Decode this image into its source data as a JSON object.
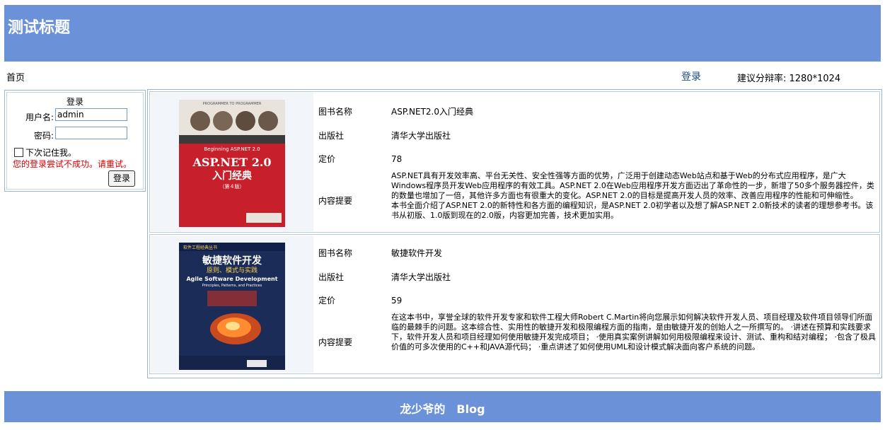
{
  "header": {
    "title": "测试标题"
  },
  "nav": {
    "home": "首页",
    "login": "登录",
    "resolution": "建议分辩率: 1280*1024"
  },
  "login": {
    "title": "登录",
    "username_label": "用户名:",
    "username_value": "admin",
    "password_label": "密码:",
    "password_value": "",
    "remember_label": "下次记住我。",
    "error": "您的登录尝试不成功。请重试。",
    "button": "登录"
  },
  "labels": {
    "name": "图书名称",
    "publisher": "出版社",
    "price": "定价",
    "summary": "内容提要"
  },
  "books": [
    {
      "name": "ASP.NET2.0入门经典",
      "publisher": "清华大学出版社",
      "price": "78",
      "summary": "ASP.NET具有开发效率高、平台无关性、安全性强等方面的优势，广泛用于创建动态Web站点和基于Web的分布式应用程序，是广大Windows程序员开发Web应用程序的有效工具。ASP.NET 2.0在Web应用程序开发方面迈出了革命性的一步，新增了50多个服务器控件，类的数量也增加了一倍，其他许多方面也有很重大的变化。ASP.NET 2.0的目标是提高开发人员的效率、改善应用程序的性能和可伸缩性。　　本书全面介绍了ASP.NET 2.0的新特性和各方面的编程知识，是ASP.NET 2.0初学者以及想了解ASP.NET 2.0新技术的读者的理想参考书。该书从初版、1.0版到现在的2.0版，内容更加完善，技术更加实用。",
      "cover": {
        "top_text": "PROGRAMMER TO PROGRAMMER",
        "subtitle": "Beginning ASP.NET 2.0",
        "title": "ASP.NET 2.0",
        "title_cn": "入门经典",
        "edition": "（第４版）",
        "bg": "#c8202a"
      }
    },
    {
      "name": "敏捷软件开发",
      "publisher": "清华大学出版社",
      "price": "59",
      "summary": "在这本书中，享誉全球的软件开发专家和软件工程大师Robert C.Martin将向您展示如何解决软件开发人员、项目经理及软件项目领导们所面临的最棘手的问题。这本综合性、实用性的敏捷开发和极限编程方面的指南，是由敏捷开发的创始人之一所撰写的。 ·讲述在预算和实践要求下，软件开发人员和项目经理如何使用敏捷开发完成项目； ·使用真实案例讲解如何用极限编程来设计、测试、重构和结对编程； ·包含了极具价值的可多次使用的C++和JAVA源代码； ·重点讲述了如何使用UML和设计模式解决面向客户系统的问题。",
      "cover": {
        "top_text": "软件工程经典丛书",
        "title_cn": "敏捷软件开发",
        "subtitle_cn": "原则、模式与实践",
        "title": "Agile Software Development",
        "subtitle": "Principles, Patterns, and Practices",
        "bg": "#1a2c57"
      }
    }
  ],
  "footer": {
    "text": "龙少爷的　Blog"
  }
}
